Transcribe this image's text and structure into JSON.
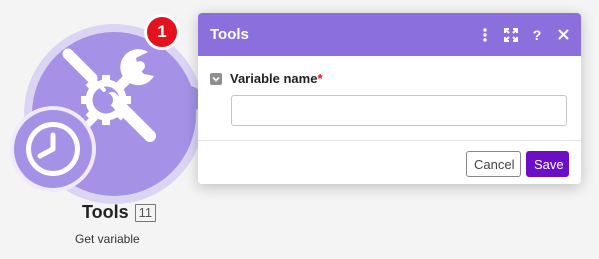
{
  "module": {
    "title": "Tools",
    "id_badge": "11",
    "subtitle": "Get variable",
    "notification_count": "1",
    "icon": "tools-icon",
    "schedule_icon": "clock-icon",
    "colors": {
      "module": "#a591e6",
      "module_ring": "#dcd4f3",
      "notification": "#e4121c"
    }
  },
  "panel": {
    "title": "Tools",
    "header_icons": [
      "more-vertical-icon",
      "expand-icon",
      "help-icon",
      "close-icon"
    ],
    "field": {
      "label": "Variable name",
      "required_mark": "*",
      "value": "",
      "placeholder": ""
    },
    "buttons": {
      "cancel": "Cancel",
      "save": "Save"
    },
    "colors": {
      "header": "#8b6fdc",
      "save_button": "#6b0fc6"
    }
  }
}
